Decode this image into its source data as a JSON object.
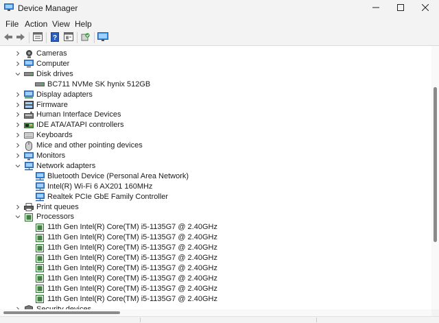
{
  "window": {
    "title": "Device Manager",
    "icon": "device-manager-icon",
    "controls": [
      "minimize-icon",
      "maximize-icon",
      "close-icon"
    ]
  },
  "menu": {
    "items": [
      "File",
      "Action",
      "View",
      "Help"
    ]
  },
  "toolbar": {
    "buttons": [
      "back-arrow-icon",
      "forward-arrow-icon",
      "properties-icon",
      "help-icon",
      "show-hidden-icon",
      "scan-hardware-icon",
      "monitor-icon"
    ]
  },
  "tree": {
    "rows": [
      {
        "label": "Cameras",
        "expanded": false,
        "icon": "camera-icon"
      },
      {
        "label": "Computer",
        "expanded": false,
        "icon": "computer-icon"
      },
      {
        "label": "Disk drives",
        "expanded": true,
        "icon": "disk-drive-icon"
      },
      {
        "label": "BC711 NVMe SK hynix 512GB",
        "icon": "disk-drive-icon"
      },
      {
        "label": "Display adapters",
        "expanded": false,
        "icon": "display-adapter-icon"
      },
      {
        "label": "Firmware",
        "expanded": false,
        "icon": "firmware-icon"
      },
      {
        "label": "Human Interface Devices",
        "expanded": false,
        "icon": "hid-icon"
      },
      {
        "label": "IDE ATA/ATAPI controllers",
        "expanded": false,
        "icon": "ide-controller-icon"
      },
      {
        "label": "Keyboards",
        "expanded": false,
        "icon": "keyboard-icon"
      },
      {
        "label": "Mice and other pointing devices",
        "expanded": false,
        "icon": "mouse-icon"
      },
      {
        "label": "Monitors",
        "expanded": false,
        "icon": "monitor-icon"
      },
      {
        "label": "Network adapters",
        "expanded": true,
        "icon": "network-adapter-icon"
      },
      {
        "label": "Bluetooth Device (Personal Area Network)",
        "icon": "network-adapter-icon"
      },
      {
        "label": "Intel(R) Wi-Fi 6 AX201 160MHz",
        "icon": "network-adapter-icon"
      },
      {
        "label": "Realtek PCIe GbE Family Controller",
        "icon": "network-adapter-icon"
      },
      {
        "label": "Print queues",
        "expanded": false,
        "icon": "printer-icon"
      },
      {
        "label": "Processors",
        "expanded": true,
        "icon": "processor-icon"
      },
      {
        "label": "11th Gen Intel(R) Core(TM) i5-1135G7 @ 2.40GHz",
        "icon": "processor-icon"
      },
      {
        "label": "11th Gen Intel(R) Core(TM) i5-1135G7 @ 2.40GHz",
        "icon": "processor-icon"
      },
      {
        "label": "11th Gen Intel(R) Core(TM) i5-1135G7 @ 2.40GHz",
        "icon": "processor-icon"
      },
      {
        "label": "11th Gen Intel(R) Core(TM) i5-1135G7 @ 2.40GHz",
        "icon": "processor-icon"
      },
      {
        "label": "11th Gen Intel(R) Core(TM) i5-1135G7 @ 2.40GHz",
        "icon": "processor-icon"
      },
      {
        "label": "11th Gen Intel(R) Core(TM) i5-1135G7 @ 2.40GHz",
        "icon": "processor-icon"
      },
      {
        "label": "11th Gen Intel(R) Core(TM) i5-1135G7 @ 2.40GHz",
        "icon": "processor-icon"
      },
      {
        "label": "11th Gen Intel(R) Core(TM) i5-1135G7 @ 2.40GHz",
        "icon": "processor-icon"
      },
      {
        "label": "Security devices",
        "expanded": false,
        "icon": "security-icon"
      }
    ]
  },
  "colors": {
    "chrome": "#f3f3f3",
    "accent_blue": "#1e7bd6",
    "processor_green": "#2f6b2f"
  }
}
